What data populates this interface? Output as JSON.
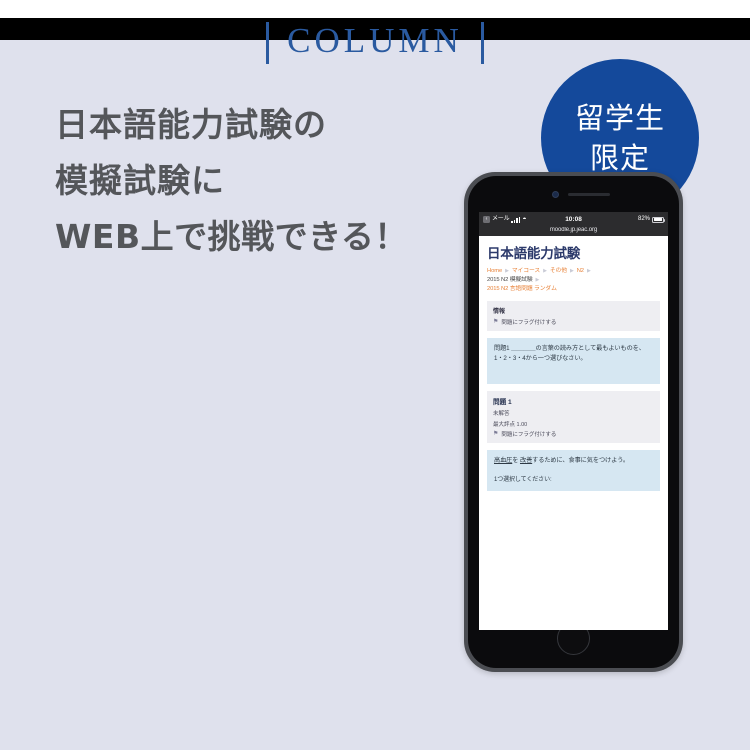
{
  "banner": {
    "eyebrow": "COLUMN",
    "headline_lines": [
      "日本語能力試験の",
      "模擬試験に",
      "WEB上で挑戦できる！"
    ],
    "badge_lines": [
      "留学生",
      "限定"
    ],
    "accent_color": "#2a5aa0",
    "badge_color": "#14499b",
    "background_color": "#dfe1ed",
    "headline_color": "#54565a"
  },
  "phone": {
    "statusbar": {
      "back_label": "メール",
      "back_icon": "back-arrow-icon",
      "signal_icon": "signal-bars-icon",
      "wifi_icon": "wifi-icon",
      "time": "10:08",
      "battery_percent": "82%",
      "battery_icon": "battery-icon"
    },
    "url": "moodle.jp.jeac.org",
    "page": {
      "site_title": "日本語能力試験",
      "breadcrumb": [
        {
          "label": "Home",
          "muted": false
        },
        {
          "label": "マイコース",
          "muted": false
        },
        {
          "label": "その他",
          "muted": false
        },
        {
          "label": "N2",
          "muted": false
        },
        {
          "label": "2015 N2 模擬試験",
          "muted": true
        },
        {
          "label": "2015 N2 言語問題 ランダム",
          "muted": false
        }
      ],
      "breadcrumb_separator": "▶",
      "info_card": {
        "title": "情報",
        "flag_label": "問題にフラグ付けする",
        "flag_icon": "flag-icon"
      },
      "instruction_box": "問題1 ＿＿＿＿の言葉の読み方として最もよいものを、1・2・3・4から一つ選びなさい。",
      "question_card": {
        "number": "問題 1",
        "status": "未解答",
        "max_grade": "最大評点 1.00",
        "flag_label": "問題にフラグ付けする",
        "flag_icon": "flag-icon"
      },
      "answer_box": {
        "sentence_pre": "",
        "term1": "高血圧",
        "mid1": "を ",
        "term2": "改善",
        "rest": "するために、食事に気をつけよう。",
        "choose_prompt": "1つ選択してください:"
      }
    }
  }
}
